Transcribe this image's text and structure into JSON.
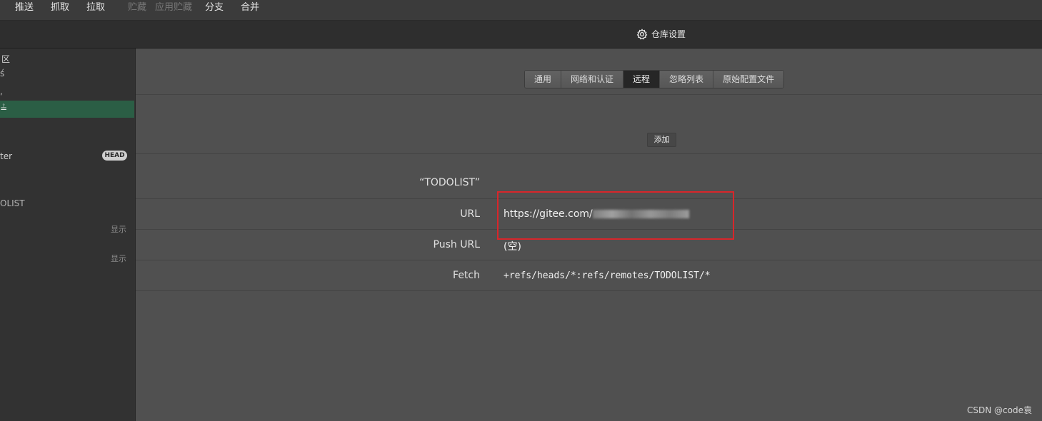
{
  "toolbar": {
    "items": [
      "推送",
      "抓取",
      "拉取",
      "贮藏",
      "应用贮藏",
      "分支",
      "合并"
    ]
  },
  "titlebar": {
    "title": "仓库设置",
    "icon": "gear-icon"
  },
  "sidebar": {
    "texts": [
      "区",
      "",
      ""
    ],
    "branch_label": "ter",
    "head_badge": "HEAD",
    "remote_label": "OLIST",
    "show_1": "显示",
    "show_2": "显示"
  },
  "settings": {
    "tabs": [
      "通用",
      "网络和认证",
      "远程",
      "忽略列表",
      "原始配置文件"
    ],
    "active_tab": "远程",
    "add_button": "添加",
    "remote_name": "“TODOLIST”",
    "url_label": "URL",
    "url_value_visible": "https://gitee.com/",
    "push_url_label": "Push URL",
    "push_url_value": "(空)",
    "fetch_label": "Fetch",
    "fetch_value": "+refs/heads/*:refs/remotes/TODOLIST/*"
  },
  "watermark": "CSDN @code袁",
  "colors": {
    "sidebar_selected": "#2b5e45",
    "highlight": "#d8262b",
    "active_tab": "#262626"
  }
}
